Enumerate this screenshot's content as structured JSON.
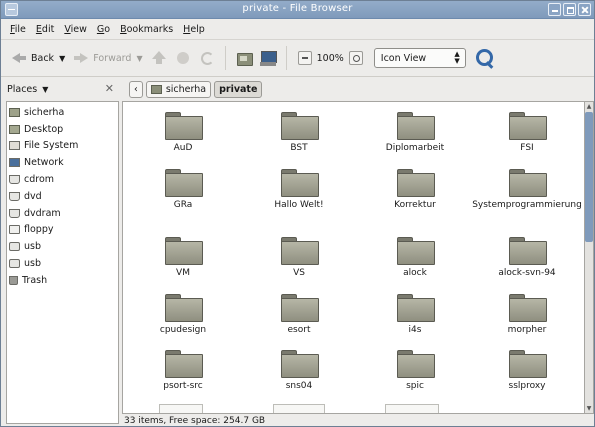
{
  "window": {
    "title": "private - File Browser"
  },
  "menubar": [
    {
      "label": "File",
      "underline": "F",
      "rest": "ile"
    },
    {
      "label": "Edit",
      "underline": "E",
      "rest": "dit"
    },
    {
      "label": "View",
      "underline": "V",
      "rest": "iew"
    },
    {
      "label": "Go",
      "underline": "G",
      "rest": "o"
    },
    {
      "label": "Bookmarks",
      "underline": "B",
      "rest": "ookmarks"
    },
    {
      "label": "Help",
      "underline": "H",
      "rest": "elp"
    }
  ],
  "toolbar": {
    "back_label": "Back",
    "forward_label": "Forward",
    "zoom_value": "100%",
    "view_mode": "Icon View"
  },
  "places": {
    "header": "Places",
    "items": [
      {
        "label": "sicherha",
        "icon": "home-folder-icon"
      },
      {
        "label": "Desktop",
        "icon": "desktop-icon"
      },
      {
        "label": "File System",
        "icon": "filesystem-icon"
      },
      {
        "label": "Network",
        "icon": "network-icon"
      },
      {
        "label": "cdrom",
        "icon": "drive-icon"
      },
      {
        "label": "dvd",
        "icon": "drive-icon"
      },
      {
        "label": "dvdram",
        "icon": "drive-icon"
      },
      {
        "label": "floppy",
        "icon": "floppy-icon"
      },
      {
        "label": "usb",
        "icon": "usb-icon"
      },
      {
        "label": "usb",
        "icon": "usb-icon"
      },
      {
        "label": "Trash",
        "icon": "trash-icon"
      }
    ]
  },
  "location": {
    "crumbs": [
      {
        "label": "sicherha"
      },
      {
        "label": "private"
      }
    ]
  },
  "files": [
    {
      "name": "AuD"
    },
    {
      "name": "BST"
    },
    {
      "name": "Diplomarbeit"
    },
    {
      "name": "FSI"
    },
    {
      "name": "GRa"
    },
    {
      "name": "Hallo Welt!"
    },
    {
      "name": "Korrektur"
    },
    {
      "name": "Systemprogrammierung"
    },
    {
      "name": "VM"
    },
    {
      "name": "VS"
    },
    {
      "name": "alock"
    },
    {
      "name": "alock-svn-94"
    },
    {
      "name": "cpudesign"
    },
    {
      "name": "esort"
    },
    {
      "name": "i4s"
    },
    {
      "name": "morpher"
    },
    {
      "name": "psort-src"
    },
    {
      "name": "sns04"
    },
    {
      "name": "spic"
    },
    {
      "name": "sslproxy"
    }
  ],
  "status": {
    "text": "33 items, Free space: 254.7 GB"
  },
  "colors": {
    "titlebar": "#8aa4c4",
    "scroll_thumb": "#7f9abb",
    "search_icon": "#3468a8"
  }
}
